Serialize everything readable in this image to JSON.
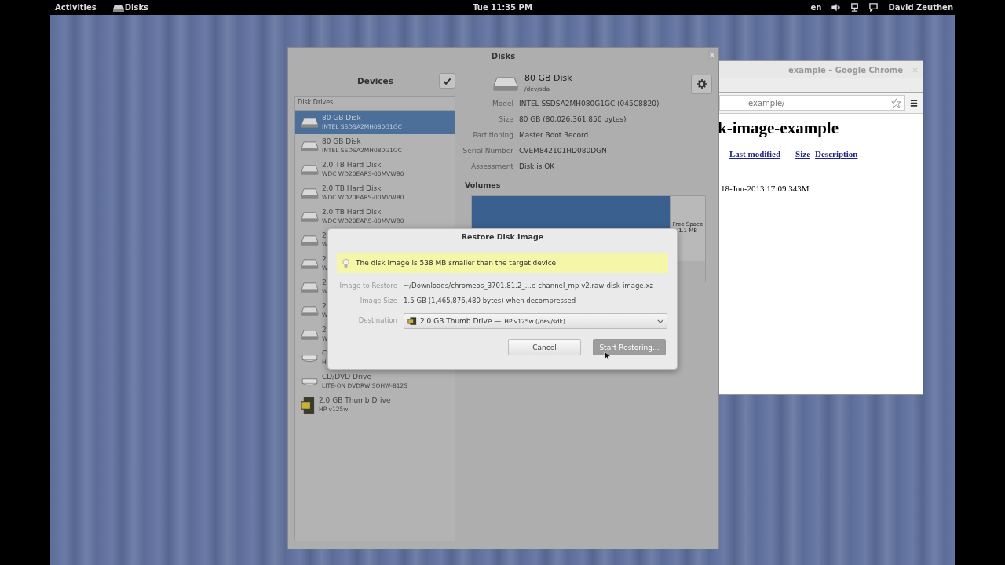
{
  "top_bar": {
    "activities": "Activities",
    "app_name": "Disks",
    "clock": "Tue 11:35 PM",
    "language": "en",
    "user": "David Zeuthen"
  },
  "browser_window": {
    "title": "example – Google Chrome",
    "url": "example/",
    "heading": "k-image-example",
    "columns": [
      "Last modified",
      "Size",
      "Description"
    ],
    "rows": [
      {
        "cells": [
          "-"
        ]
      },
      {
        "cells": [
          "18-Jun-2013 17:09 343M"
        ]
      }
    ]
  },
  "disks_window": {
    "title": "Disks",
    "sidebar": {
      "title": "Devices",
      "section": "Disk Drives",
      "items": [
        {
          "name": "80 GB Disk",
          "model": "INTEL SSDSA2MH080G1GC",
          "kind": "drive",
          "selected": true
        },
        {
          "name": "80 GB Disk",
          "model": "INTEL SSDSA2MH080G1GC",
          "kind": "drive",
          "selected": false
        },
        {
          "name": "2.0 TB Hard Disk",
          "model": "WDC WD20EARS-00MVWB0",
          "kind": "drive",
          "selected": false
        },
        {
          "name": "2.0 TB Hard Disk",
          "model": "WDC WD20EARS-00MVWB0",
          "kind": "drive",
          "selected": false
        },
        {
          "name": "2.0 TB Hard Disk",
          "model": "WDC WD20EARS-00MVWB0",
          "kind": "drive",
          "selected": false
        },
        {
          "name": "2",
          "model": "W",
          "kind": "drive",
          "selected": false
        },
        {
          "name": "2",
          "model": "W",
          "kind": "drive",
          "selected": false
        },
        {
          "name": "2",
          "model": "W",
          "kind": "drive",
          "selected": false
        },
        {
          "name": "2",
          "model": "W",
          "kind": "drive",
          "selected": false
        },
        {
          "name": "2",
          "model": "W",
          "kind": "drive",
          "selected": false
        },
        {
          "name": "C",
          "model": "H",
          "kind": "optical",
          "selected": false
        },
        {
          "name": "CD/DVD Drive",
          "model": "LITE-ON DVDRW SOHW-812S",
          "kind": "optical",
          "selected": false
        },
        {
          "name": "2.0 GB Thumb Drive",
          "model": "HP v125w",
          "kind": "thumb",
          "selected": false
        }
      ]
    },
    "drive": {
      "name": "80 GB Disk",
      "device": "/dev/sda",
      "properties": [
        {
          "label": "Model",
          "value": "INTEL SSDSA2MH080G1GC (045C8820)"
        },
        {
          "label": "Size",
          "value": "80 GB (80,026,361,856 bytes)"
        },
        {
          "label": "Partitioning",
          "value": "Master Boot Record"
        },
        {
          "label": "Serial Number",
          "value": "CVEM842101HD080DGN"
        },
        {
          "label": "Assessment",
          "value": "Disk is OK"
        }
      ],
      "volumes_title": "Volumes",
      "free_space": {
        "label": "Free Space",
        "size": "1.1 MB"
      }
    }
  },
  "dialog": {
    "title": "Restore Disk Image",
    "info": "The disk image is 538 MB smaller than the target device",
    "fields": [
      {
        "label": "Image to Restore",
        "value": "~/Downloads/chromeos_3701.81.2_...e-channel_mp-v2.raw-disk-image.xz"
      },
      {
        "label": "Image Size",
        "value": "1.5 GB (1,465,876,480 bytes) when decompressed"
      }
    ],
    "destination": {
      "label": "Destination",
      "name": "2.0 GB Thumb Drive —",
      "detail": "HP v125w (/dev/sdk)"
    },
    "buttons": [
      {
        "label": "Cancel",
        "disabled": false
      },
      {
        "label": "Start Restoring...",
        "disabled": true
      }
    ]
  }
}
